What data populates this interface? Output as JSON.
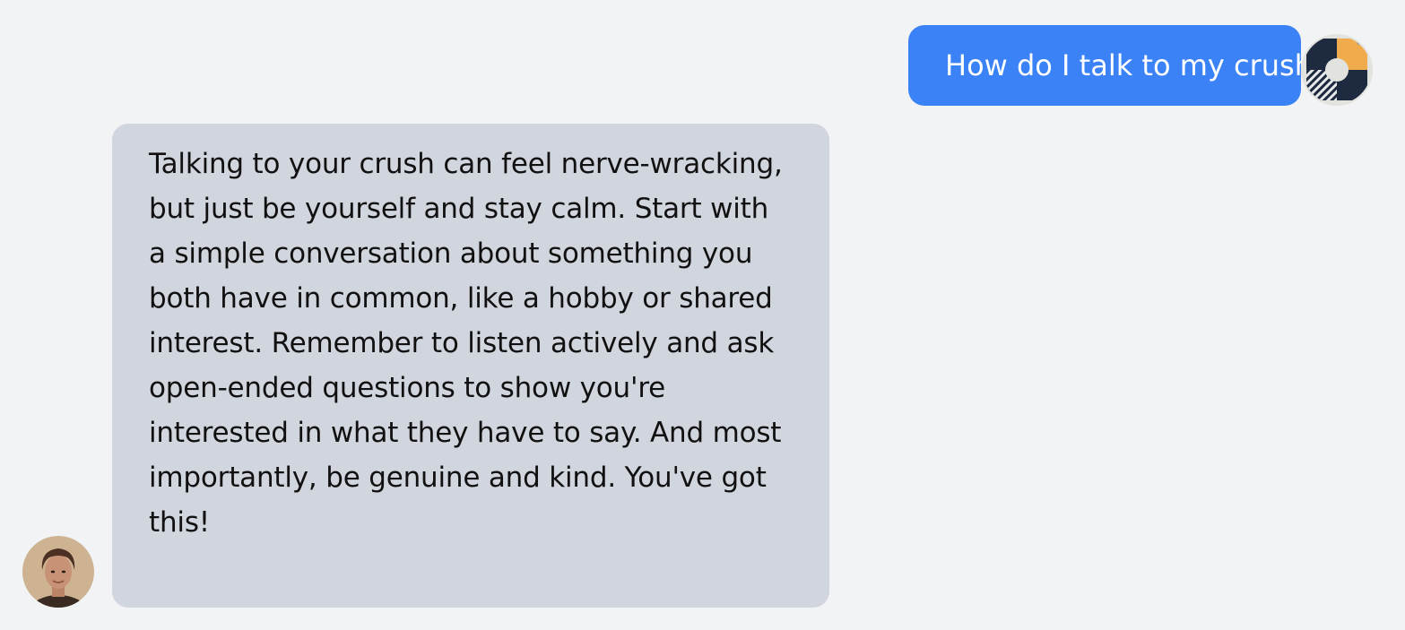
{
  "conversation": {
    "user_message": "How do I talk to my crush?",
    "assistant_message": "Talking to your crush can feel nerve-wracking, but just be yourself and stay calm. Start with a simple conversation about something you both have in common, like a hobby or shared interest. Remember to listen actively and ask open-ended questions to show you're interested in what they have to say. And most importantly, be genuine and kind. You've got this!"
  },
  "colors": {
    "background": "#f2f3f5",
    "user_bubble": "#3b82f6",
    "assistant_bubble": "#d1d5de"
  },
  "icons": {
    "user_avatar": "abstract-avatar-icon",
    "assistant_avatar": "person-portrait-avatar"
  }
}
